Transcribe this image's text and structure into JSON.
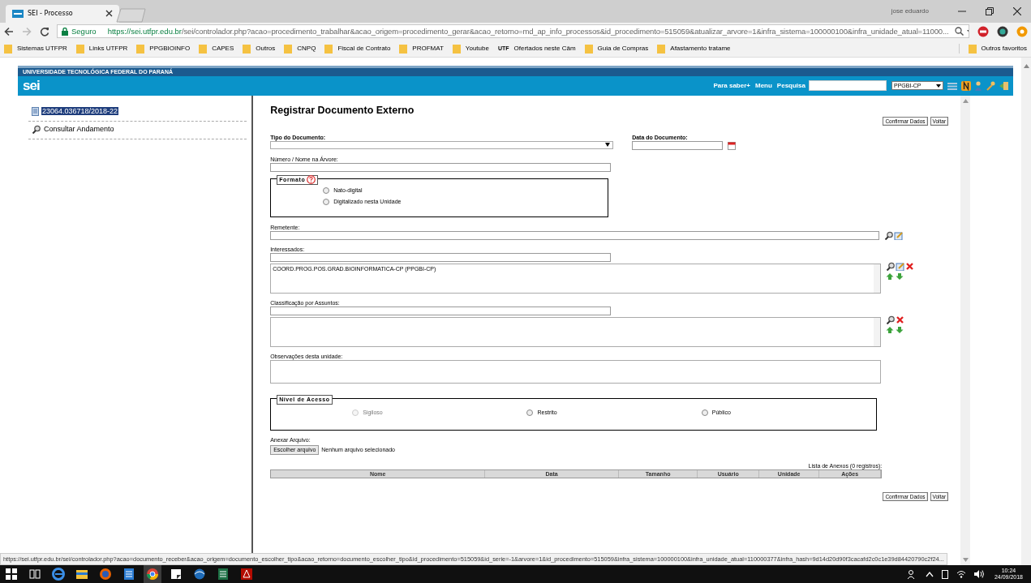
{
  "browser": {
    "tabs": [
      {
        "title": "SEI - Processo",
        "selected": true
      }
    ],
    "user": "jose eduardo",
    "address": {
      "secure_label": "Seguro",
      "url_host": "https://sei.utfpr.edu.br",
      "url_path": "/sei/controlador.php?acao=procedimento_trabalhar&acao_origem=procedimento_gerar&acao_retorno=md_ap_info_processos&id_procedimento=515059&atualizar_arvore=1&infra_sistema=100000100&infra_unidade_atual=11000..."
    },
    "bookmarks": [
      {
        "label": "Sistemas UTFPR",
        "kind": "folder"
      },
      {
        "label": "Links UTFPR",
        "kind": "folder"
      },
      {
        "label": "PPGBIOINFO",
        "kind": "folder"
      },
      {
        "label": "CAPES",
        "kind": "folder"
      },
      {
        "label": "Outros",
        "kind": "folder"
      },
      {
        "label": "CNPQ",
        "kind": "folder"
      },
      {
        "label": "Fiscal de Contrato",
        "kind": "folder"
      },
      {
        "label": "PROFMAT",
        "kind": "folder"
      },
      {
        "label": "Youtube",
        "kind": "folder"
      },
      {
        "label": "Ofertados neste Câm",
        "kind": "site",
        "favicon_text": "UTF"
      },
      {
        "label": "Guia de Compras",
        "kind": "folder"
      },
      {
        "label": "Afastamento tratame",
        "kind": "folder"
      }
    ],
    "other_bookmarks": "Outros favoritos"
  },
  "sei": {
    "org": "UNIVERSIDADE TECNOLÓGICA FEDERAL DO PARANÁ",
    "logo": "sei",
    "links": [
      "Para saber+",
      "Menu",
      "Pesquisa"
    ],
    "unit": "PPGBI-CP"
  },
  "sidebar": {
    "items": [
      {
        "label": "23064.036718/2018-22",
        "kind": "process",
        "selected": true
      },
      {
        "label": "Consultar Andamento",
        "kind": "search",
        "selected": false
      }
    ]
  },
  "form": {
    "title": "Registrar Documento Externo",
    "buttons": [
      "Confirmar Dados",
      "Voltar"
    ],
    "tipo_label": "Tipo do Documento:",
    "data_label": "Data do Documento:",
    "numero_label": "Número / Nome na Árvore:",
    "formato": {
      "legend": "Formato",
      "options": [
        {
          "label": "Nato-digital",
          "selected": false
        },
        {
          "label": "Digitalizado nesta Unidade",
          "selected": false
        }
      ]
    },
    "remetente_label": "Remetente:",
    "interessados_label": "Interessados:",
    "interessados": [
      "COORD.PROG.POS.GRAD.BIOINFORMATICA-CP (PPGBI-CP)"
    ],
    "assuntos_label": "Classificação por Assuntos:",
    "observacoes_label": "Observações desta unidade:",
    "acesso": {
      "legend": "Nível de Acesso",
      "options": [
        {
          "label": "Sigiloso",
          "selected": false,
          "disabled": true
        },
        {
          "label": "Restrito",
          "selected": false,
          "disabled": false
        },
        {
          "label": "Público",
          "selected": false,
          "disabled": false
        }
      ]
    },
    "anexar_label": "Anexar Arquivo:",
    "file_button": "Escolher arquivo",
    "file_status": "Nenhum arquivo selecionado",
    "anexos_caption": "Lista de Anexos (0 registros):",
    "anexos_columns": [
      "Nome",
      "Data",
      "Tamanho",
      "Usuário",
      "Unidade",
      "Ações"
    ],
    "bottom_buttons": [
      "Confirmar Dados",
      "Voltar"
    ]
  },
  "status_url": "https://sei.utfpr.edu.br/sei/controlador.php?acao=documento_receber&acao_origem=documento_escolher_tipo&acao_retorno=documento_escolher_tipo&id_procedimento=515059&id_serie=-1&arvore=1&id_procedimento=515059&infra_sistema=100000100&infra_unidade_atual=110000377&infra_hash=9d14d20d90f3cacafd2c0c1e39d84420790c2f24...",
  "taskbar": {
    "time": "10:24",
    "date": "24/09/2018"
  }
}
